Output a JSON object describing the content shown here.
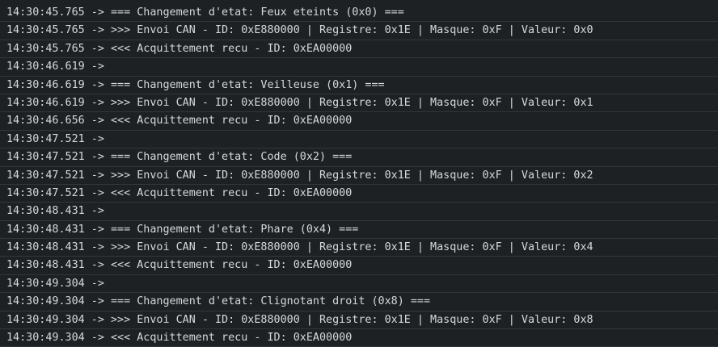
{
  "log": {
    "lines": [
      "14:30:45.765 -> === Changement d'etat: Feux eteints (0x0) ===",
      "14:30:45.765 -> >>> Envoi CAN - ID: 0xE880000 | Registre: 0x1E | Masque: 0xF | Valeur: 0x0",
      "14:30:45.765 -> <<< Acquittement recu - ID: 0xEA00000",
      "14:30:46.619 ->",
      "14:30:46.619 -> === Changement d'etat: Veilleuse (0x1) ===",
      "14:30:46.619 -> >>> Envoi CAN - ID: 0xE880000 | Registre: 0x1E | Masque: 0xF | Valeur: 0x1",
      "14:30:46.656 -> <<< Acquittement recu - ID: 0xEA00000",
      "14:30:47.521 ->",
      "14:30:47.521 -> === Changement d'etat: Code (0x2) ===",
      "14:30:47.521 -> >>> Envoi CAN - ID: 0xE880000 | Registre: 0x1E | Masque: 0xF | Valeur: 0x2",
      "14:30:47.521 -> <<< Acquittement recu - ID: 0xEA00000",
      "14:30:48.431 ->",
      "14:30:48.431 -> === Changement d'etat: Phare (0x4) ===",
      "14:30:48.431 -> >>> Envoi CAN - ID: 0xE880000 | Registre: 0x1E | Masque: 0xF | Valeur: 0x4",
      "14:30:48.431 -> <<< Acquittement recu - ID: 0xEA00000",
      "14:30:49.304 ->",
      "14:30:49.304 -> === Changement d'etat: Clignotant droit (0x8) ===",
      "14:30:49.304 -> >>> Envoi CAN - ID: 0xE880000 | Registre: 0x1E | Masque: 0xF | Valeur: 0x8",
      "14:30:49.304 -> <<< Acquittement recu - ID: 0xEA00000"
    ]
  }
}
